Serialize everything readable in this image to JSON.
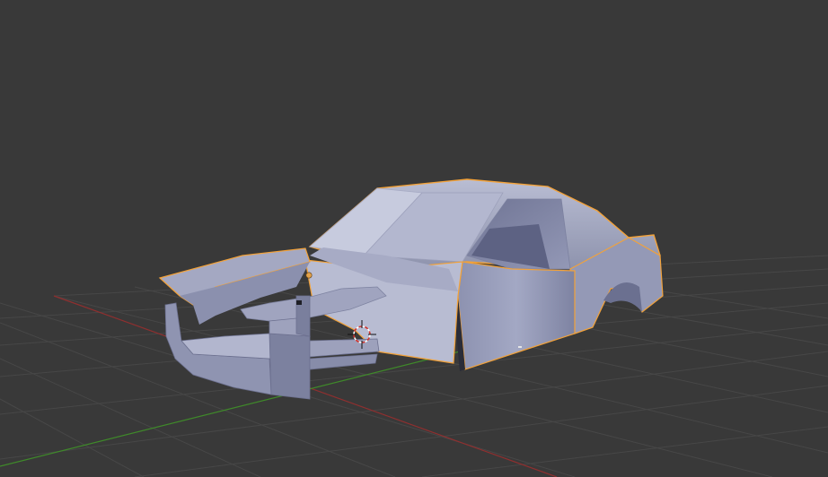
{
  "viewport": {
    "background_color": "#393939",
    "grid_color": "#4a4a4a",
    "x_axis_color": "#8f2f2f",
    "y_axis_color": "#3f8a2a",
    "selection_outline_color": "#f2a23a"
  },
  "scene": {
    "selected_object": "car-body-mesh",
    "mesh_base_color": "#9a9fba",
    "cursor_icon": "3d-cursor-icon",
    "origin_icon": "object-origin-icon"
  }
}
